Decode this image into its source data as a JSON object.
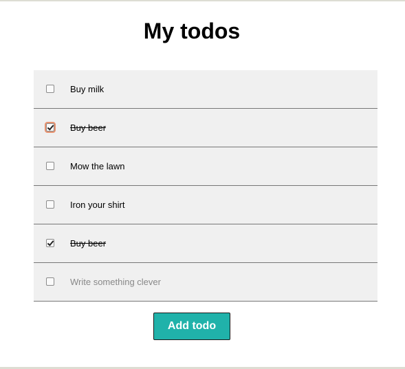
{
  "page": {
    "title": "My todos"
  },
  "todos": [
    {
      "text": "Buy milk",
      "checked": false,
      "focused": false,
      "placeholder": false
    },
    {
      "text": "Buy beer",
      "checked": true,
      "focused": true,
      "placeholder": false
    },
    {
      "text": "Mow the lawn",
      "checked": false,
      "focused": false,
      "placeholder": false
    },
    {
      "text": "Iron your shirt",
      "checked": false,
      "focused": false,
      "placeholder": false
    },
    {
      "text": "Buy beer",
      "checked": true,
      "focused": false,
      "placeholder": false
    },
    {
      "text": "Write something clever",
      "checked": false,
      "focused": false,
      "placeholder": true
    }
  ],
  "actions": {
    "add_label": "Add todo"
  },
  "colors": {
    "accent": "#20b2aa",
    "row_background": "#f0f0f0",
    "focus_ring": "#e8926f"
  }
}
